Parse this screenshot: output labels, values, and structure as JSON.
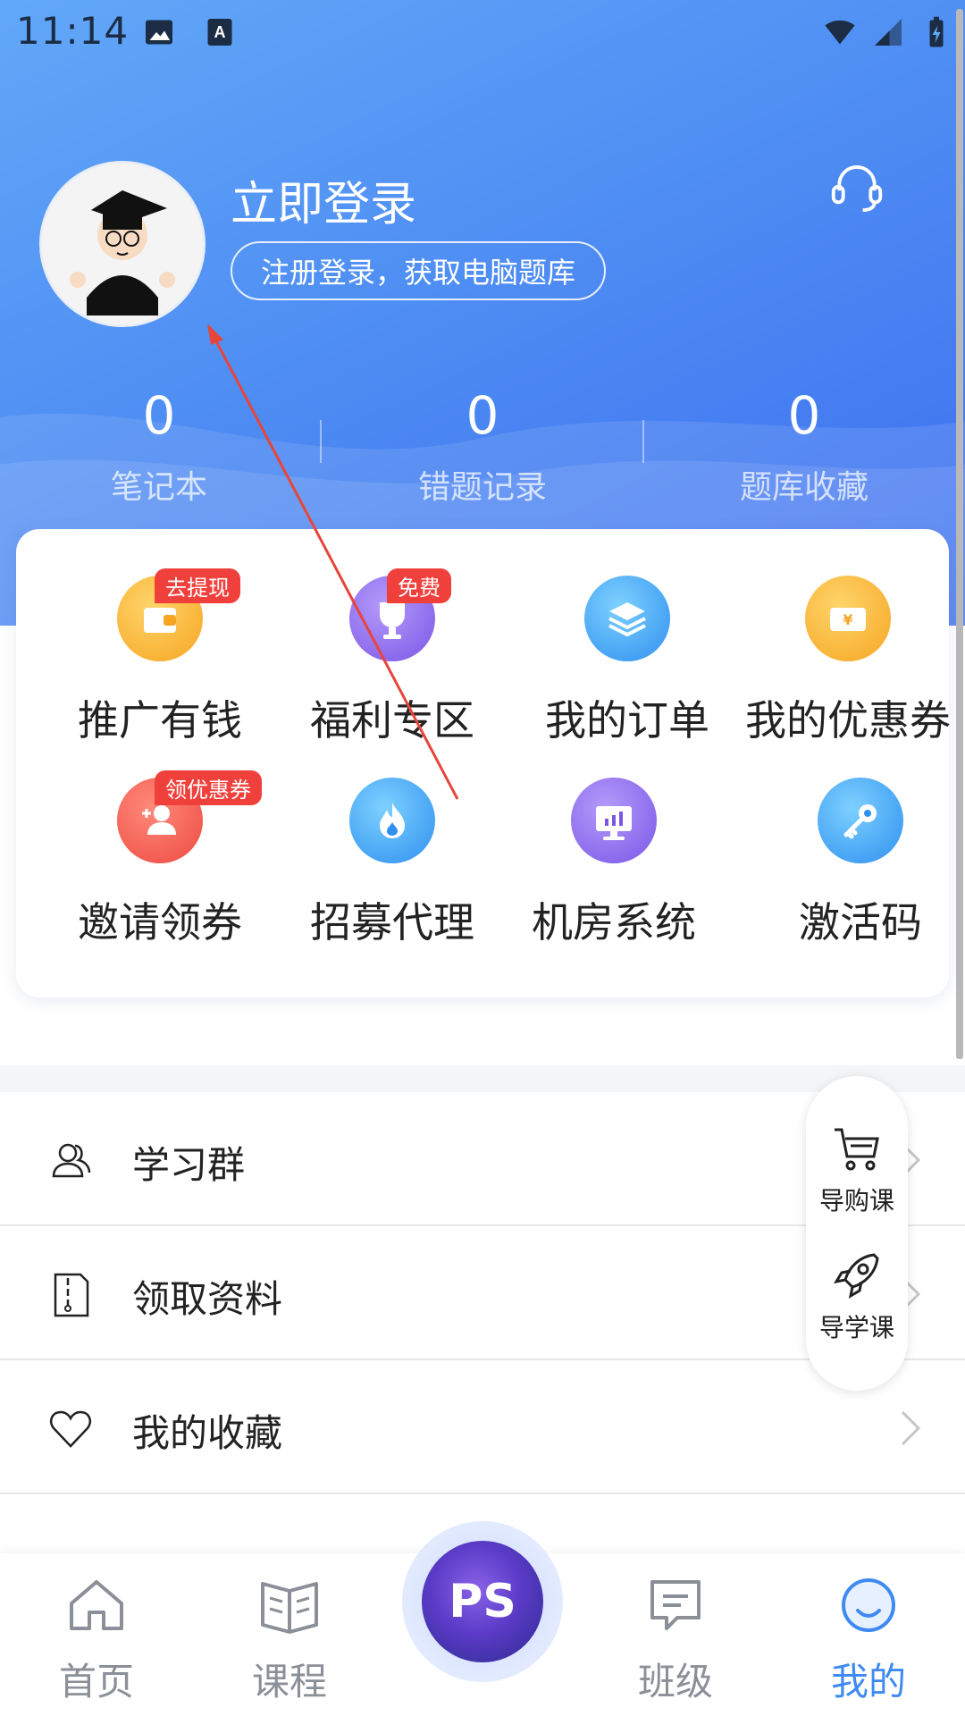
{
  "status_bar": {
    "time": "11:14"
  },
  "profile": {
    "login_title": "立即登录",
    "register_text": "注册登录，获取电脑题库"
  },
  "stats": [
    {
      "value": "0",
      "label": "笔记本"
    },
    {
      "value": "0",
      "label": "错题记录"
    },
    {
      "value": "0",
      "label": "题库收藏"
    }
  ],
  "grid": [
    {
      "label": "推广有钱",
      "badge": "去提现",
      "icon": "wallet-icon",
      "color": "#f7b733"
    },
    {
      "label": "福利专区",
      "badge": "免费",
      "icon": "trophy-icon",
      "color": "#8d6cf0"
    },
    {
      "label": "我的订单",
      "badge": "",
      "icon": "layers-icon",
      "color": "#3aa6f2"
    },
    {
      "label": "我的优惠券",
      "badge": "",
      "icon": "coupon-icon",
      "color": "#f7b733"
    },
    {
      "label": "邀请领券",
      "badge": "领优惠券",
      "icon": "add-user-icon",
      "color": "#f2564f"
    },
    {
      "label": "招募代理",
      "badge": "",
      "icon": "flame-icon",
      "color": "#3aa6f2"
    },
    {
      "label": "机房系统",
      "badge": "",
      "icon": "monitor-icon",
      "color": "#8d6cf0"
    },
    {
      "label": "激活码",
      "badge": "",
      "icon": "key-icon",
      "color": "#3aa6f2"
    }
  ],
  "list": [
    {
      "label": "学习群",
      "icon": "group-icon"
    },
    {
      "label": "领取资料",
      "icon": "document-icon"
    },
    {
      "label": "我的收藏",
      "icon": "heart-icon"
    }
  ],
  "side_panel": [
    {
      "label": "导购课",
      "icon": "cart-icon"
    },
    {
      "label": "导学课",
      "icon": "rocket-icon"
    }
  ],
  "bottom_nav": [
    {
      "label": "首页",
      "icon": "home-icon",
      "active": false
    },
    {
      "label": "课程",
      "icon": "book-icon",
      "active": false
    },
    {
      "label": "班级",
      "icon": "chat-icon",
      "active": false
    },
    {
      "label": "我的",
      "icon": "profile-icon",
      "active": true
    }
  ],
  "center_button": {
    "text": "PS"
  },
  "colors": {
    "accent": "#3f8af2",
    "badge": "#f0403c",
    "hero_start": "#62a8f8",
    "hero_end": "#3d6ff0"
  }
}
